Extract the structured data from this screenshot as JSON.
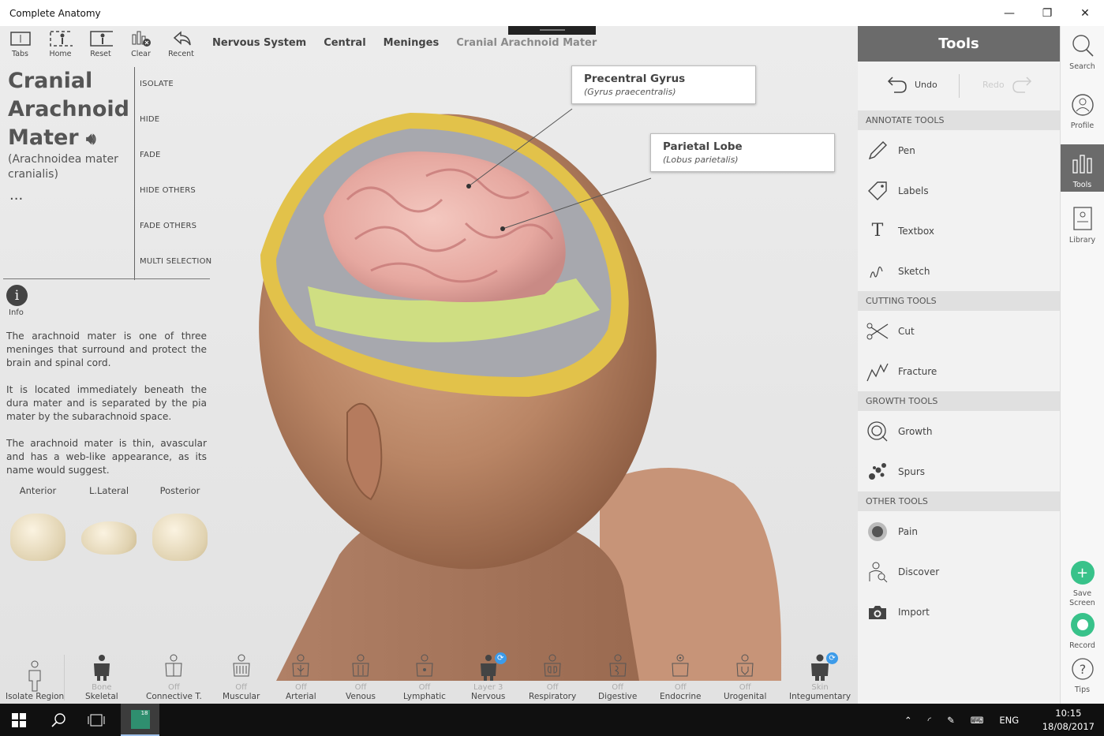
{
  "window": {
    "title": "Complete Anatomy",
    "controls": [
      "—",
      "❐",
      "✕"
    ]
  },
  "toolbar": [
    {
      "id": "tabs",
      "label": "Tabs",
      "icon": "tabs-icon"
    },
    {
      "id": "home",
      "label": "Home",
      "icon": "home-icon"
    },
    {
      "id": "reset",
      "label": "Reset",
      "icon": "reset-icon"
    },
    {
      "id": "clear",
      "label": "Clear",
      "icon": "clear-icon"
    },
    {
      "id": "recent",
      "label": "Recent",
      "icon": "recent-icon"
    }
  ],
  "breadcrumb": [
    "Nervous System",
    "Central",
    "Meninges",
    "Cranial Arachnoid Mater"
  ],
  "structure": {
    "title_line1": "Cranial",
    "title_line2": "Arachnoid",
    "title_line3": "Mater",
    "latin": "(Arachnoidea mater cranialis)",
    "more": "..."
  },
  "actions": [
    "ISOLATE",
    "HIDE",
    "FADE",
    "HIDE OTHERS",
    "FADE OTHERS",
    "MULTI SELECTION"
  ],
  "info": {
    "icon_text": "i",
    "label": "Info"
  },
  "description": [
    "The arachnoid mater is one of three meninges that surround and protect the brain and spinal cord.",
    "It is located immediately beneath the dura mater and is separated by the pia mater by the subarachnoid space.",
    "The arachnoid mater is thin, avascular and has a web-like appearance, as its name would suggest."
  ],
  "views": [
    "Anterior",
    "L.Lateral",
    "Posterior"
  ],
  "callouts": [
    {
      "name": "Precentral Gyrus",
      "latin": "(Gyrus praecentralis)"
    },
    {
      "name": "Parietal Lobe",
      "latin": "(Lobus parietalis)"
    }
  ],
  "systems": [
    {
      "state": "",
      "name": "Isolate Region"
    },
    {
      "state": "Bone",
      "name": "Skeletal"
    },
    {
      "state": "Off",
      "name": "Connective T."
    },
    {
      "state": "Off",
      "name": "Muscular"
    },
    {
      "state": "Off",
      "name": "Arterial"
    },
    {
      "state": "Off",
      "name": "Venous"
    },
    {
      "state": "Off",
      "name": "Lymphatic"
    },
    {
      "state": "Layer 3",
      "name": "Nervous"
    },
    {
      "state": "Off",
      "name": "Respiratory"
    },
    {
      "state": "Off",
      "name": "Digestive"
    },
    {
      "state": "Off",
      "name": "Endocrine"
    },
    {
      "state": "Off",
      "name": "Urogenital"
    },
    {
      "state": "Skin",
      "name": "Integumentary"
    }
  ],
  "tools_panel": {
    "title": "Tools",
    "undo": "Undo",
    "redo": "Redo",
    "sections": [
      {
        "title": "ANNOTATE TOOLS",
        "items": [
          "Pen",
          "Labels",
          "Textbox",
          "Sketch"
        ]
      },
      {
        "title": "CUTTING TOOLS",
        "items": [
          "Cut",
          "Fracture"
        ]
      },
      {
        "title": "GROWTH TOOLS",
        "items": [
          "Growth",
          "Spurs"
        ]
      },
      {
        "title": "OTHER TOOLS",
        "items": [
          "Pain",
          "Discover",
          "Import"
        ]
      }
    ]
  },
  "right_nav": {
    "search": "Search",
    "profile": "Profile",
    "tools": "Tools",
    "library": "Library",
    "save_screen": "Save Screen",
    "record": "Record",
    "tips": "Tips"
  },
  "taskbar": {
    "lang": "ENG",
    "time": "10:15",
    "date": "18/08/2017",
    "app_badge": "18"
  },
  "colors": {
    "tools_header": "#6b6b6b",
    "accent_green": "#38c28a",
    "badge_blue": "#3d9be9"
  }
}
